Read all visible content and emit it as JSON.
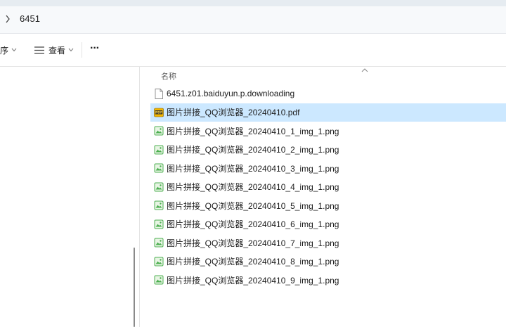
{
  "address": {
    "path": "6451"
  },
  "toolbar": {
    "sort_label": "排序",
    "view_label": "查看",
    "more_label": "···"
  },
  "columns": {
    "name": "名称"
  },
  "files": [
    {
      "name": "6451.z01.baiduyun.p.downloading",
      "icon": "generic-file-icon",
      "selected": false
    },
    {
      "name": "图片拼接_QQ浏览器_20240410.pdf",
      "icon": "pdf-file-icon",
      "selected": true
    },
    {
      "name": "图片拼接_QQ浏览器_20240410_1_img_1.png",
      "icon": "png-file-icon",
      "selected": false
    },
    {
      "name": "图片拼接_QQ浏览器_20240410_2_img_1.png",
      "icon": "png-file-icon",
      "selected": false
    },
    {
      "name": "图片拼接_QQ浏览器_20240410_3_img_1.png",
      "icon": "png-file-icon",
      "selected": false
    },
    {
      "name": "图片拼接_QQ浏览器_20240410_4_img_1.png",
      "icon": "png-file-icon",
      "selected": false
    },
    {
      "name": "图片拼接_QQ浏览器_20240410_5_img_1.png",
      "icon": "png-file-icon",
      "selected": false
    },
    {
      "name": "图片拼接_QQ浏览器_20240410_6_img_1.png",
      "icon": "png-file-icon",
      "selected": false
    },
    {
      "name": "图片拼接_QQ浏览器_20240410_7_img_1.png",
      "icon": "png-file-icon",
      "selected": false
    },
    {
      "name": "图片拼接_QQ浏览器_20240410_8_img_1.png",
      "icon": "png-file-icon",
      "selected": false
    },
    {
      "name": "图片拼接_QQ浏览器_20240410_9_img_1.png",
      "icon": "png-file-icon",
      "selected": false
    }
  ],
  "colors": {
    "selection": "#cce8ff",
    "address_bg": "#f7f9fb",
    "pdf_badge": "#f5b800",
    "png_badge": "#4caf50"
  }
}
